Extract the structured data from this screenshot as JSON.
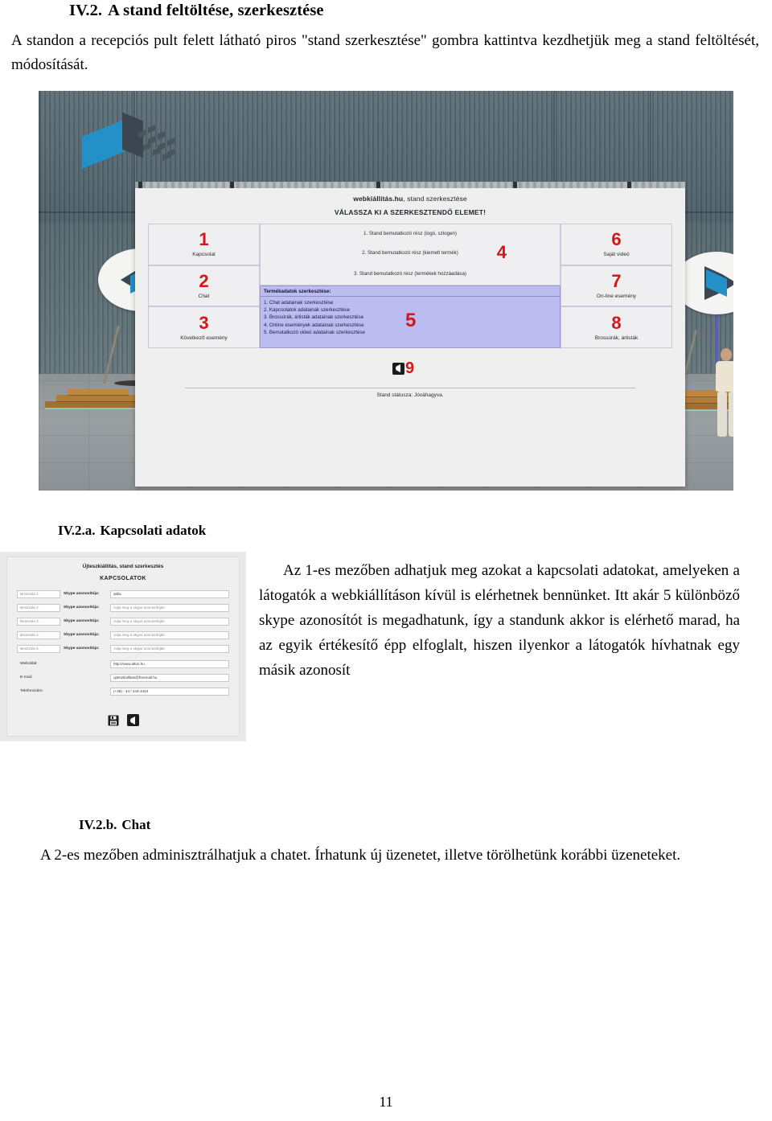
{
  "document": {
    "section_title": {
      "number": "IV.2.",
      "text": "A stand feltöltése, szerkesztése"
    },
    "intro_paragraph": "A standon a recepciós pult felett látható piros \"stand szerkesztése\" gombra kattintva kezdhetjük meg a stand feltöltését, módosítását.",
    "page_number": "11"
  },
  "stand_editor": {
    "title_brand": "webkiállítás.hu",
    "title_rest": ", stand szerkesztése",
    "subtitle": "VÁLASSZA KI A SZERKESZTENDŐ ELEMET!",
    "left_cells": [
      {
        "number": "1",
        "caption": "Kapcsolat"
      },
      {
        "number": "2",
        "caption": "Chat"
      },
      {
        "number": "3",
        "caption": "Következő esemény"
      }
    ],
    "right_cells": [
      {
        "number": "6",
        "caption": "Saját videó"
      },
      {
        "number": "7",
        "caption": "On-line esemény"
      },
      {
        "number": "8",
        "caption": "Brossúrák, árlisták"
      }
    ],
    "center_top": {
      "number": "4",
      "lines": [
        "1. Stand bemutatkozó rész (logó, szlogen)",
        "2. Stand bemutatkozó rész (kiemelt termék)",
        "3. Stand bemutatkozó rész (termékek hozzáadása)"
      ]
    },
    "center_list": {
      "number": "5",
      "heading": "Termékadatok szerkesztése:",
      "items": [
        "1. Chat adatainak szerkesztése",
        "2. Kapcsolatok adatainak szerkesztése",
        "3. Brossúrák, árlisták adatainak szerkesztése",
        "4. Online események adatainak szerkesztése",
        "5. Bemutatkozó videó adatainak szerkesztése"
      ]
    },
    "back_button": {
      "number": "9",
      "icon": "chevron-left-icon"
    },
    "status_text": "Stand státusza: Jóváhagyva."
  },
  "section_a": {
    "heading_number": "IV.2.a.",
    "heading_text": "Kapcsolati adatok",
    "paragraph": "Az 1-es mezőben adhatjuk meg azokat a kapcsolati adatokat, amelyeken a látogatók a webkiállításon kívül is elérhetnek bennünket. Itt akár 5 különböző skype azonosítót is megadhatunk, így a standunk akkor is elérhető marad, ha az egyik értékesítő épp elfoglalt, hiszen ilyenkor a látogatók hívhatnak egy másik azonosít"
  },
  "contacts_form": {
    "title_brand": "Újteszkiállítás",
    "title_rest": ", stand szerkesztés",
    "subtitle": "KAPCSOLATOK",
    "skype_rows": [
      {
        "position_placeholder": "Beosztás 1.",
        "label": "Skype azonosítója:",
        "value": "attila",
        "placeholder": ""
      },
      {
        "position_placeholder": "Beosztás 2.",
        "label": "Skype azonosítója:",
        "value": "",
        "placeholder": "Adja meg a skype azonosítóját!"
      },
      {
        "position_placeholder": "Beosztás 3.",
        "label": "Skype azonosítója:",
        "value": "",
        "placeholder": "Adja meg a skype azonosítóját!"
      },
      {
        "position_placeholder": "Beosztás 4.",
        "label": "Skype azonosítója:",
        "value": "",
        "placeholder": "Adja meg a skype azonosítóját!"
      },
      {
        "position_placeholder": "Beosztás 5.",
        "label": "Skype azonosítója:",
        "value": "",
        "placeholder": "Adja meg a skype azonosítóját!"
      }
    ],
    "detail_rows": [
      {
        "label": "Weboldal:",
        "value": "http://www.alton.hu"
      },
      {
        "label": "E-mail:",
        "value": "ujteszkiallitas@freemail.hu"
      },
      {
        "label": "Telefonszám:",
        "value": "(+36) - 44 / 444-4444"
      }
    ],
    "save_icon": "save-floppy-icon",
    "back_icon": "chevron-left-icon"
  },
  "section_b": {
    "heading_number": "IV.2.b.",
    "heading_text": "Chat",
    "paragraph": "A 2-es mezőben adminisztrálhatjuk a chatet. Írhatunk új üzenetet, illetve törölhetünk korábbi üzeneteket."
  },
  "colors": {
    "accent_red": "#d31616",
    "list_purple": "#bcbcf0",
    "logo_blue": "#2390c8",
    "wall_grey": "#4e6069"
  }
}
